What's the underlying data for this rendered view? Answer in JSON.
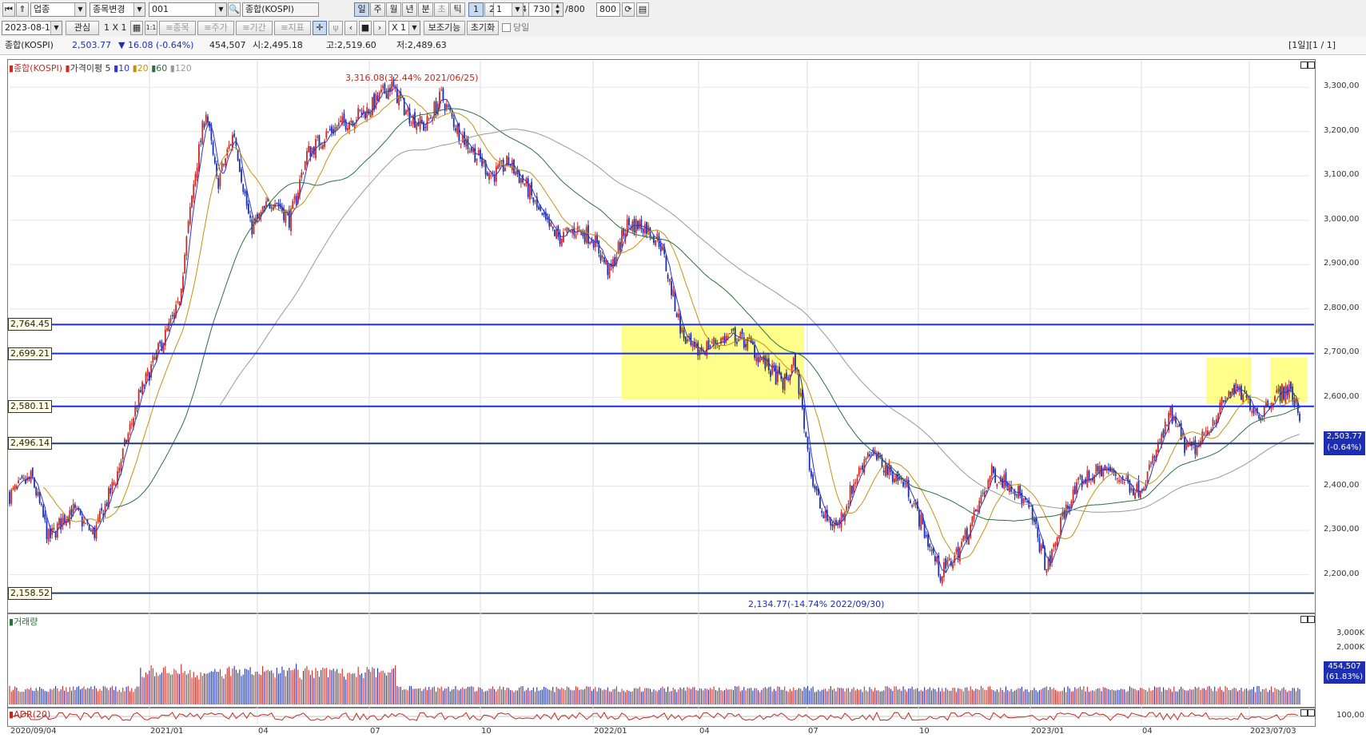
{
  "toolbar1": {
    "market": "업종",
    "change_label": "종목변경",
    "code": "001",
    "name": "종합(KOSPI)",
    "periods": [
      "일",
      "주",
      "월",
      "년",
      "분",
      "초",
      "틱"
    ],
    "active_period": 0,
    "numbers": [
      "1",
      "2",
      "3",
      "4"
    ],
    "active_number": 0,
    "interval": "1",
    "count": "730",
    "total": "/800",
    "max": "800"
  },
  "toolbar2": {
    "date": "2023-08-18",
    "interest": "관심",
    "grid": "1 X 1",
    "tag_jongmok": "≡종목",
    "tag_juga": "≡주가",
    "tag_gigan": "≡기간",
    "tag_jipyo": "≡지표",
    "multiplier": "X 1",
    "aux_label": "보조기능",
    "reset_label": "초기화",
    "today_label": "당일"
  },
  "info": {
    "name": "종합(KOSPI)",
    "price": "2,503.77",
    "change": "▼ 16.08 (-0.64%)",
    "volume": "454,507",
    "open": "시:2,495.18",
    "high": "고:2,519.60",
    "low": "저:2,489.63",
    "pages": "[1일][1 / 1]"
  },
  "legend": {
    "name": "종합(KOSPI)",
    "indicator": "가격이평 5",
    "ma": [
      "10",
      "20",
      "60",
      "120"
    ]
  },
  "annotations": {
    "high": "3,316.08(32.44% 2021/06/25)",
    "low": "2,134.77(-14.74% 2022/09/30)"
  },
  "hlines": [
    {
      "label": "2,764.45",
      "value": 2764.45,
      "color": "#1a2fd0"
    },
    {
      "label": "2,699.21",
      "value": 2699.21,
      "color": "#1a2fd0"
    },
    {
      "label": "2,580.11",
      "value": 2580.11,
      "color": "#1a2fd0"
    },
    {
      "label": "2,496.14",
      "value": 2496.14,
      "color": "#1e3c6e"
    },
    {
      "label": "2,158.52",
      "value": 2158.52,
      "color": "#1e3c6e"
    }
  ],
  "price_axis": [
    "3,300,00",
    "3,200,00",
    "3,100,00",
    "3,000,00",
    "2,900,00",
    "2,800,00",
    "2,700,00",
    "2,600,00",
    "2,400,00",
    "2,300,00",
    "2,200,00"
  ],
  "price_current": {
    "value": "2,503.77",
    "change": "(-0.64%)"
  },
  "volume_panel": {
    "title": "거래량",
    "ticks": [
      "3,000K",
      "2,000K"
    ],
    "current": "454,507",
    "pct": "(61.83%)"
  },
  "adr_panel": {
    "title": "ADR(20)",
    "ticks": [
      "100,00"
    ]
  },
  "dates": [
    "2020/09/04",
    "2021/01",
    "04",
    "07",
    "10",
    "2022/01",
    "04",
    "07",
    "10",
    "2023/01",
    "04",
    "2023/07/03"
  ],
  "colors": {
    "up": "#d0281e",
    "down": "#1c2fb4",
    "ma5": "#3333cc",
    "ma20": "#c89010",
    "ma60": "#2a7040",
    "ma120": "#999999",
    "zone": "#ffff66"
  },
  "chart_data": {
    "type": "candlestick",
    "title": "종합(KOSPI)",
    "ylim": [
      2120,
      3360
    ],
    "x": [
      "2020/09/04",
      "2020/10",
      "2020/11",
      "2020/12",
      "2021/01",
      "2021/02",
      "2021/03",
      "2021/04",
      "2021/05",
      "2021/06",
      "2021/07",
      "2021/08",
      "2021/09",
      "2021/10",
      "2021/11",
      "2021/12",
      "2022/01",
      "2022/02",
      "2022/03",
      "2022/04",
      "2022/05",
      "2022/06",
      "2022/07",
      "2022/08",
      "2022/09",
      "2022/10",
      "2022/11",
      "2022/12",
      "2023/01",
      "2023/02",
      "2023/03",
      "2023/04",
      "2023/05",
      "2023/06",
      "2023/07",
      "2023/08"
    ],
    "series": [
      {
        "name": "종합(KOSPI)",
        "values": [
          2380,
          2350,
          2330,
          2700,
          3050,
          3050,
          3000,
          3150,
          3200,
          3300,
          3230,
          3150,
          3050,
          2970,
          2960,
          2990,
          2700,
          2720,
          2700,
          2680,
          2650,
          2350,
          2450,
          2480,
          2200,
          2260,
          2450,
          2400,
          2420,
          2400,
          2450,
          2510,
          2570,
          2590,
          2600,
          2503.77
        ]
      },
      {
        "name": "120",
        "values": [
          null,
          null,
          null,
          2300,
          2420,
          2580,
          2760,
          2900,
          3050,
          3120,
          3170,
          3180,
          3150,
          3080,
          3000,
          2920,
          2840,
          2800,
          2760,
          2720,
          2680,
          2630,
          2580,
          2540,
          2480,
          2440,
          2400,
          2360,
          2350,
          2350,
          2360,
          2380,
          2410,
          2440,
          2470,
          2490
        ]
      }
    ]
  }
}
